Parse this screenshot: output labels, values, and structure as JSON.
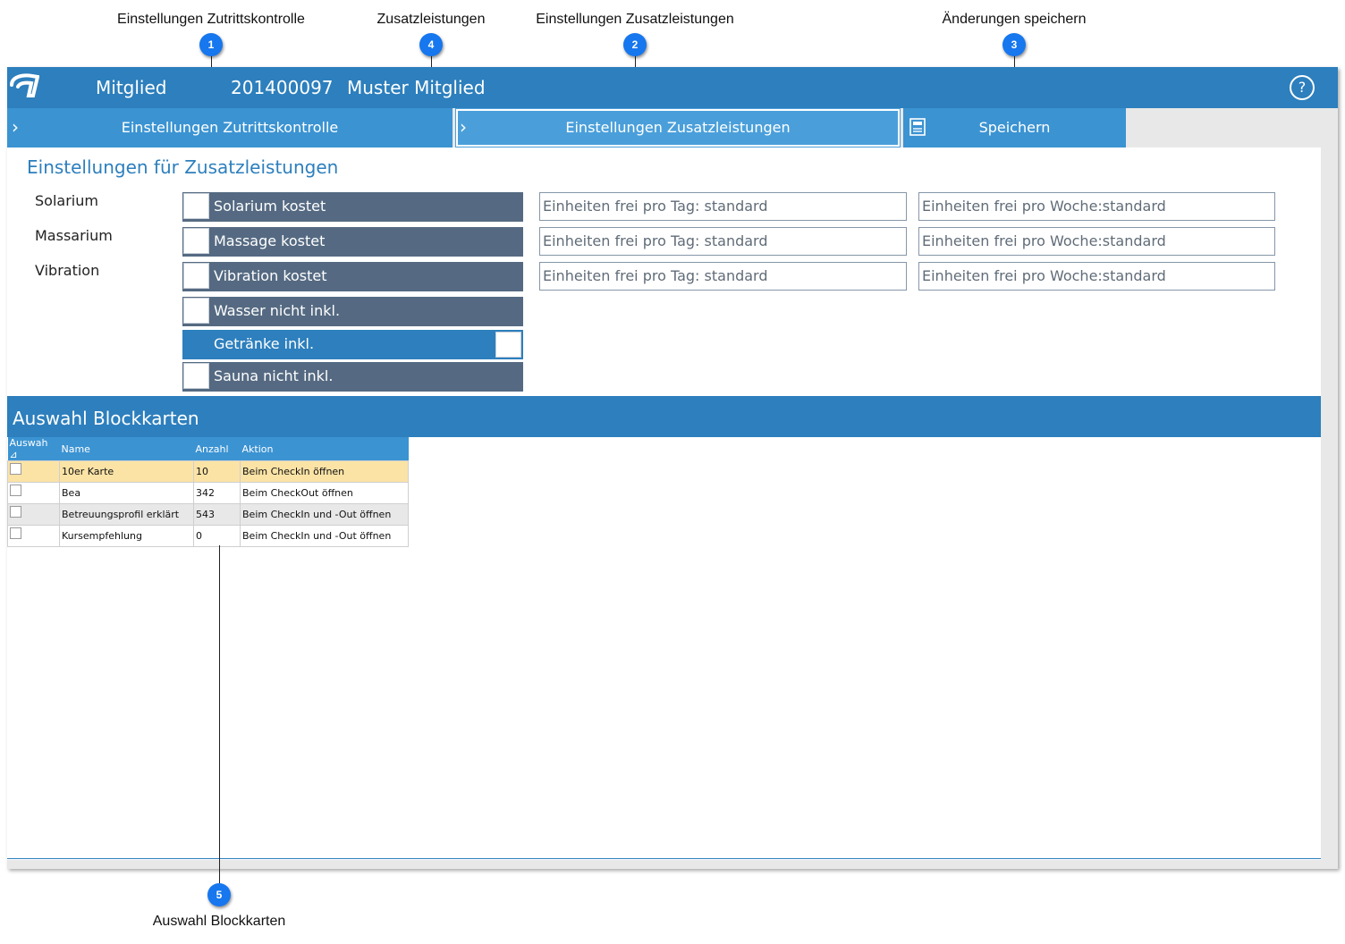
{
  "callouts": [
    {
      "number": "1",
      "label": "Einstellungen Zutrittskontrolle"
    },
    {
      "number": "4",
      "label": "Zusatzleistungen"
    },
    {
      "number": "2",
      "label": "Einstellungen Zusatzleistungen"
    },
    {
      "number": "3",
      "label": "Änderungen speichern"
    },
    {
      "number": "5",
      "label": "Auswahl Blockkarten"
    }
  ],
  "header": {
    "logo": "app-logo",
    "section": "Mitglied",
    "member_number": "201400097",
    "member_name": "Muster Mitglied",
    "help": "?"
  },
  "nav": {
    "access_control": "Einstellungen Zutrittskontrolle",
    "extra_services": "Einstellungen Zusatzleistungen",
    "save": "Speichern"
  },
  "extras": {
    "title": "Einstellungen für Zusatzleistungen",
    "row_labels": [
      "Solarium",
      "Massarium",
      "Vibration"
    ],
    "toggles": [
      {
        "label": "Solarium kostet",
        "on": false
      },
      {
        "label": "Massage kostet",
        "on": false
      },
      {
        "label": "Vibration kostet",
        "on": false
      },
      {
        "label": "Wasser nicht inkl.",
        "on": false
      },
      {
        "label": "Getränke inkl.",
        "on": true
      },
      {
        "label": "Sauna nicht inkl.",
        "on": false
      }
    ],
    "per_day": [
      "Einheiten frei pro Tag: standard",
      "Einheiten frei pro Tag: standard",
      "Einheiten frei pro Tag: standard"
    ],
    "per_week": [
      "Einheiten frei pro Woche:standard",
      "Einheiten frei pro Woche:standard",
      "Einheiten frei pro Woche:standard"
    ]
  },
  "blockcards": {
    "title": "Auswahl Blockkarten",
    "columns": [
      "Auswah",
      "Name",
      "Anzahl",
      "Aktion"
    ],
    "sort_indicator": "⊿",
    "rows": [
      {
        "name": "10er Karte",
        "count": "10",
        "action": "Beim CheckIn öffnen"
      },
      {
        "name": "Bea",
        "count": "342",
        "action": "Beim CheckOut öffnen"
      },
      {
        "name": "Betreuungsprofil erklärt",
        "count": "543",
        "action": "Beim CheckIn und -Out öffnen"
      },
      {
        "name": "Kursempfehlung",
        "count": "0",
        "action": "Beim CheckIn und -Out öffnen"
      }
    ]
  },
  "colors": {
    "primary": "#2d7fbd",
    "nav": "#3b93d2",
    "toggle_off": "#556a82",
    "selected_row": "#fbe3a6",
    "badge": "#1677ee"
  }
}
